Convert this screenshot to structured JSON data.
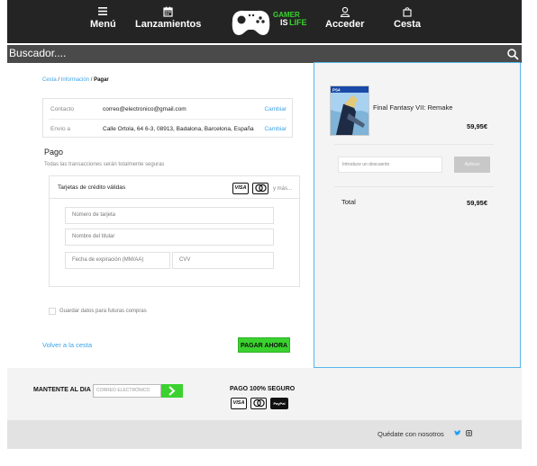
{
  "header": {
    "menu_label": "Menú",
    "releases_label": "Lanzamientos",
    "login_label": "Acceder",
    "cart_label": "Cesta",
    "logo_text_top": "GAMER",
    "logo_text_mid": "IS",
    "logo_text_bottom": "LIFE"
  },
  "search": {
    "placeholder": "Buscador...."
  },
  "breadcrumb": {
    "cart": "Cesta",
    "info": "Información",
    "payment": "Pagar",
    "separator": "/"
  },
  "contact": {
    "contact_key": "Contacto",
    "contact_value": "correo@electronico@gmail.com",
    "ship_key": "Envío a",
    "ship_value": "Calle Ortola, 64 6-3, 08913, Badalona, Barcelona, España",
    "change_label": "Cambiar"
  },
  "payment": {
    "title": "Pago",
    "subtitle": "Todas las transacciones serán totalmente seguras",
    "cards_title": "Tarjetas de crédito válidas",
    "more_label": "y más...",
    "visa_label": "VISA",
    "card_number_placeholder": "Número de tarjeta",
    "holder_placeholder": "Nombre del titular",
    "expiry_placeholder": "Fecha de expiración (MM/AA)",
    "cvv_placeholder": "CVV",
    "save_label": "Guardar datos para futuras compras",
    "back_label": "Volver a la cesta",
    "pay_label": "PAGAR AHORA"
  },
  "summary": {
    "product_name": "Final Fantasy VII: Remake",
    "product_price": "59,95€",
    "discount_placeholder": "Introduce un descuento",
    "apply_label": "Aplicar",
    "total_label": "Total",
    "total_value": "59,95€"
  },
  "footer": {
    "newsletter_label": "MANTENTE AL DIA",
    "email_placeholder": "CORREO ELECTRÓNICO",
    "secure_label": "PAGO 100% SEGURO",
    "visa_label": "VISA",
    "paypal_label": "PayPal",
    "follow_label": "Quédate con nosotros"
  },
  "colors": {
    "accent_blue": "#3ba3e8",
    "pay_green": "#3bd22f",
    "header_dark": "#242424",
    "search_gray": "#4a4a4a",
    "summary_border": "#58b6ea"
  },
  "icons": [
    "hamburger-menu-icon",
    "calendar-icon",
    "gamepad-logo-icon",
    "user-icon",
    "shopping-bag-icon",
    "search-icon",
    "visa-icon",
    "mastercard-icon",
    "paypal-icon",
    "arrow-right-icon",
    "twitter-icon",
    "instagram-icon"
  ]
}
